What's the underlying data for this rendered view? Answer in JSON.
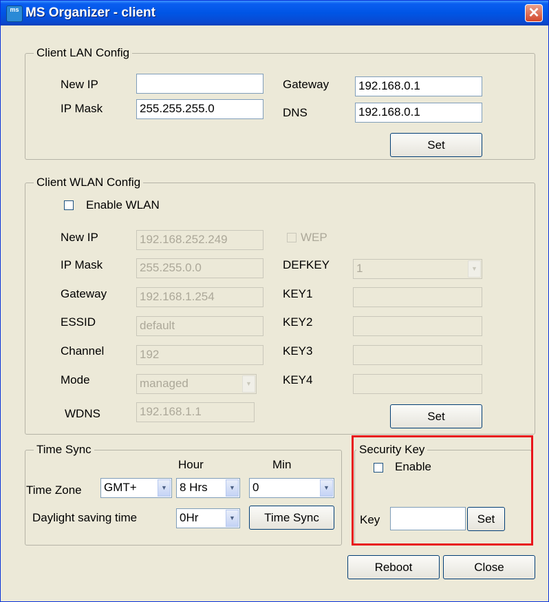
{
  "window": {
    "title": "MS Organizer - client",
    "icon_text": "ms",
    "close_glyph": "✕"
  },
  "lan": {
    "legend": "Client LAN Config",
    "new_ip_label": "New IP",
    "new_ip_value": "",
    "ip_mask_label": "IP Mask",
    "ip_mask_value": "255.255.255.0",
    "gateway_label": "Gateway",
    "gateway_value": "192.168.0.1",
    "dns_label": "DNS",
    "dns_value": "192.168.0.1",
    "set_label": "Set"
  },
  "wlan": {
    "legend": "Client WLAN Config",
    "enable_label": "Enable WLAN",
    "new_ip_label": "New IP",
    "new_ip_value": "192.168.252.249",
    "ip_mask_label": "IP Mask",
    "ip_mask_value": "255.255.0.0",
    "gateway_label": "Gateway",
    "gateway_value": "192.168.1.254",
    "essid_label": "ESSID",
    "essid_value": "default",
    "channel_label": "Channel",
    "channel_value": "192",
    "mode_label": "Mode",
    "mode_value": "managed",
    "wdns_label": "WDNS",
    "wdns_value": "192.168.1.1",
    "wep_label": "WEP",
    "defkey_label": "DEFKEY",
    "defkey_value": "1",
    "key1_label": "KEY1",
    "key2_label": "KEY2",
    "key3_label": "KEY3",
    "key4_label": "KEY4",
    "set_label": "Set"
  },
  "time_sync": {
    "legend": "Time Sync",
    "hour_label": "Hour",
    "min_label": "Min",
    "time_zone_label": "Time Zone",
    "time_zone_value": "GMT+",
    "hour_value": "8 Hrs",
    "min_value": "0",
    "dst_label": "Daylight saving time",
    "dst_value": "0Hr",
    "time_sync_button": "Time Sync"
  },
  "security": {
    "legend": "Security Key",
    "enable_label": "Enable",
    "key_label": "Key",
    "key_value": "",
    "set_label": "Set"
  },
  "footer": {
    "reboot_label": "Reboot",
    "close_label": "Close"
  },
  "colors": {
    "highlight_box": "#e8141b",
    "title_bar": "#0055e5",
    "dialog_bg": "#ece9d8"
  }
}
